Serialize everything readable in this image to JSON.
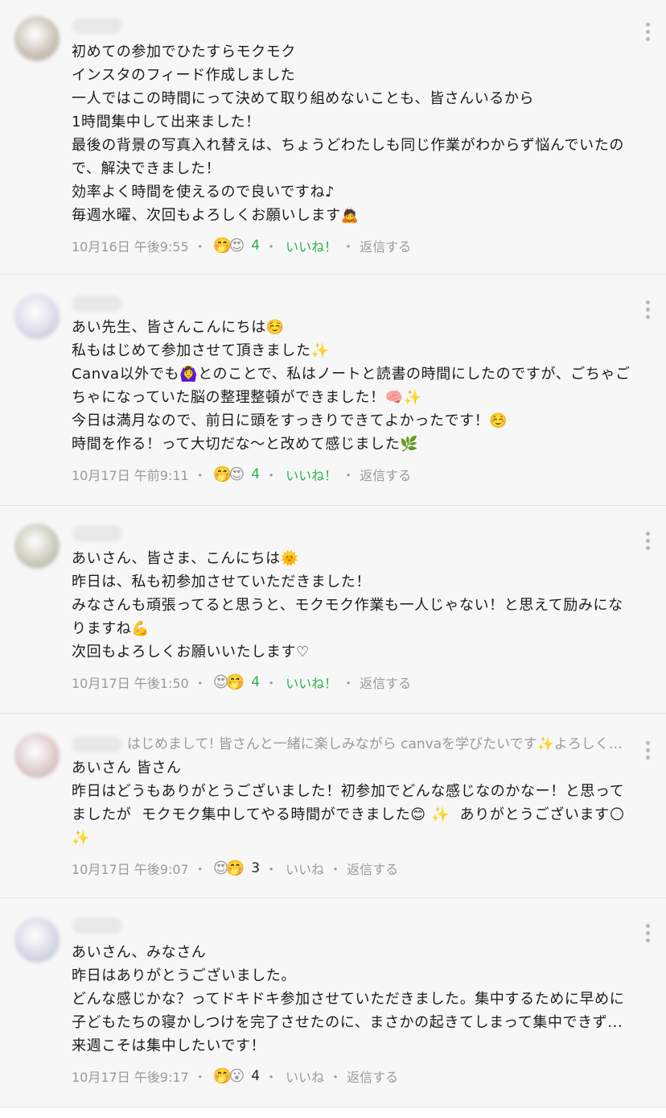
{
  "comments": [
    {
      "avatar_color": "#c9bfb3",
      "header_text": "",
      "lines": "初めての参加でひたすらモクモク\nインスタのフィード作成しました\n一人ではこの時間にって決めて取り組めないことも、皆さんいるから\n1時間集中して出来ました！\n最後の背景の写真入れ替えは、ちょうどわたしも同じ作業がわからず悩んでいたので、解決できました！\n効率よく時間を使えるので良いですね♪\n毎週水曜、次回もよろしくお願いします🙇",
      "timestamp": "10月16日 午後9:55",
      "reactions": [
        "🤭",
        "😍"
      ],
      "count": "4",
      "like_label": "いいね！",
      "liked": true,
      "reply_label": "返信する"
    },
    {
      "avatar_color": "#d7d9ea",
      "header_text": "",
      "lines": "あい先生、皆さんこんにちは☺️\n私もはじめて参加させて頂きました✨\nCanva以外でも🙆‍♀️とのことで、私はノートと読書の時間にしたのですが、ごちゃごちゃになっていた脳の整理整頓ができました！🧠✨\n今日は満月なので、前日に頭をすっきりできてよかったです！☺️\n時間を作る！って大切だな〜と改めて感じました🌿",
      "timestamp": "10月17日 午前9:11",
      "reactions": [
        "🤭",
        "😍"
      ],
      "count": "4",
      "like_label": "いいね！",
      "liked": true,
      "reply_label": "返信する"
    },
    {
      "avatar_color": "#c8c8b8",
      "header_text": "",
      "lines": "あいさん、皆さま、こんにちは🌞\n昨日は、私も初参加させていただきました！\nみなさんも頑張ってると思うと、モクモク作業も一人じゃない！と思えて励みになりますね💪\n次回もよろしくお願いいたします♡",
      "timestamp": "10月17日 午後1:50",
      "reactions": [
        "😍",
        "🤭"
      ],
      "count": "4",
      "like_label": "いいね！",
      "liked": true,
      "reply_label": "返信する"
    },
    {
      "avatar_color": "#dcc8c8",
      "header_text": "はじめまして! 皆さんと一緒に楽しみながら canvaを学びたいです✨よろしくお願いします",
      "lines": "あいさん 皆さん\n昨日はどうもありがとうございました！初参加でどんな感じなのかなー！と思ってましたが  モクモク集中してやる時間ができました😊 ✨  ありがとうございます🌕 ✨",
      "timestamp": "10月17日 午後9:07",
      "reactions": [
        "😍",
        "🤭"
      ],
      "count": "3",
      "like_label": "いいね",
      "liked": false,
      "reply_label": "返信する"
    },
    {
      "avatar_color": "#d3d6e6",
      "header_text": "",
      "lines": "あいさん、みなさん\n昨日はありがとうございました。\nどんな感じかな？ってドキドキ参加させていただきました。集中するために早めに子どもたちの寝かしつけを完了させたのに、まさかの起きてしまって集中できず...来週こそは集中したいです！",
      "timestamp": "10月17日 午後9:17",
      "reactions": [
        "🤭",
        "😮"
      ],
      "count": "4",
      "like_label": "いいね",
      "liked": false,
      "reply_label": "返信する"
    }
  ]
}
